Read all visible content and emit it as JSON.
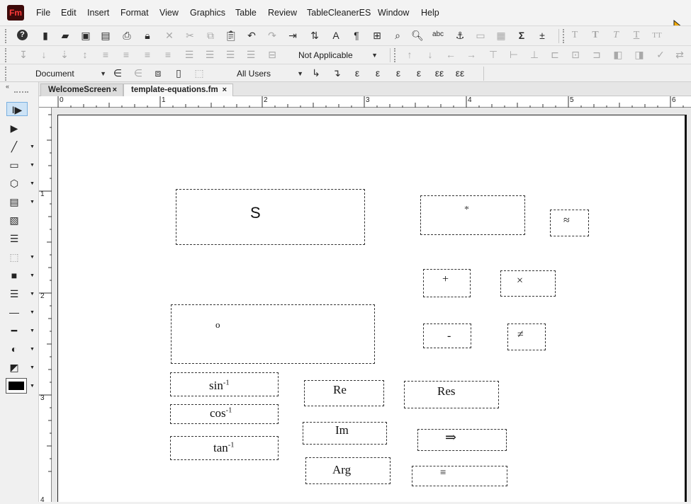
{
  "app": {
    "logo": "Fm"
  },
  "menu": [
    "File",
    "Edit",
    "Insert",
    "Format",
    "View",
    "Graphics",
    "Table",
    "Review",
    "TableCleanerES",
    "Window",
    "Help"
  ],
  "toolbar": {
    "condition_select": "Not Applicable",
    "scope_select": "Document",
    "users_select": "All Users"
  },
  "tabs": [
    {
      "label": "WelcomeScreen",
      "close": "×"
    },
    {
      "label": "template-equations.fm",
      "close": "×"
    }
  ],
  "ruler": {
    "horizontal": [
      "0",
      "1",
      "2",
      "3",
      "4",
      "5",
      "6"
    ],
    "vertical": [
      "1",
      "2",
      "3",
      "4"
    ]
  },
  "equations": {
    "s": "S",
    "asterisk": "*",
    "approx": "≈",
    "plus": "+",
    "times": "×",
    "circle": "o",
    "minus": "-",
    "neq": "≠",
    "sin": "sin",
    "cos": "cos",
    "tan": "tan",
    "inverse_exp": "-1",
    "re": "Re",
    "res": "Res",
    "im": "Im",
    "implies": "⇒",
    "arg": "Arg",
    "equiv": "≡"
  },
  "icons": {
    "menu_toolbar": [
      "help-icon",
      "new-document-icon",
      "open-folder-icon",
      "save-icon",
      "save-as-icon",
      "print-icon",
      "lock-icon",
      "delete-icon",
      "cut-icon",
      "copy-icon",
      "paste-icon",
      "undo-icon",
      "redo-icon",
      "rerun-icon",
      "import-icon",
      "character-catalog-icon",
      "paragraph-catalog-icon",
      "table-catalog-icon",
      "find-icon",
      "zoom-icon",
      "spelling-icon",
      "anchor-icon",
      "text-frame-icon",
      "table-icon",
      "sigma-icon",
      "insert-equation-icon"
    ],
    "tool_panel": [
      "text-select-tool-icon",
      "object-select-tool-icon",
      "line-tool-icon",
      "rectangle-tool-icon",
      "polygon-tool-icon",
      "text-frame-tool-icon",
      "image-tool-icon",
      "hotspot-tool-icon",
      "frame-border-tool-icon",
      "fill-color-icon",
      "line-width-icon",
      "line-style-icon",
      "dash-style-icon",
      "tint-icon",
      "overprint-icon",
      "color-swatch-icon"
    ]
  },
  "colors": {
    "accent": "#3d0a0a",
    "logo_text": "#ff3b3b"
  }
}
